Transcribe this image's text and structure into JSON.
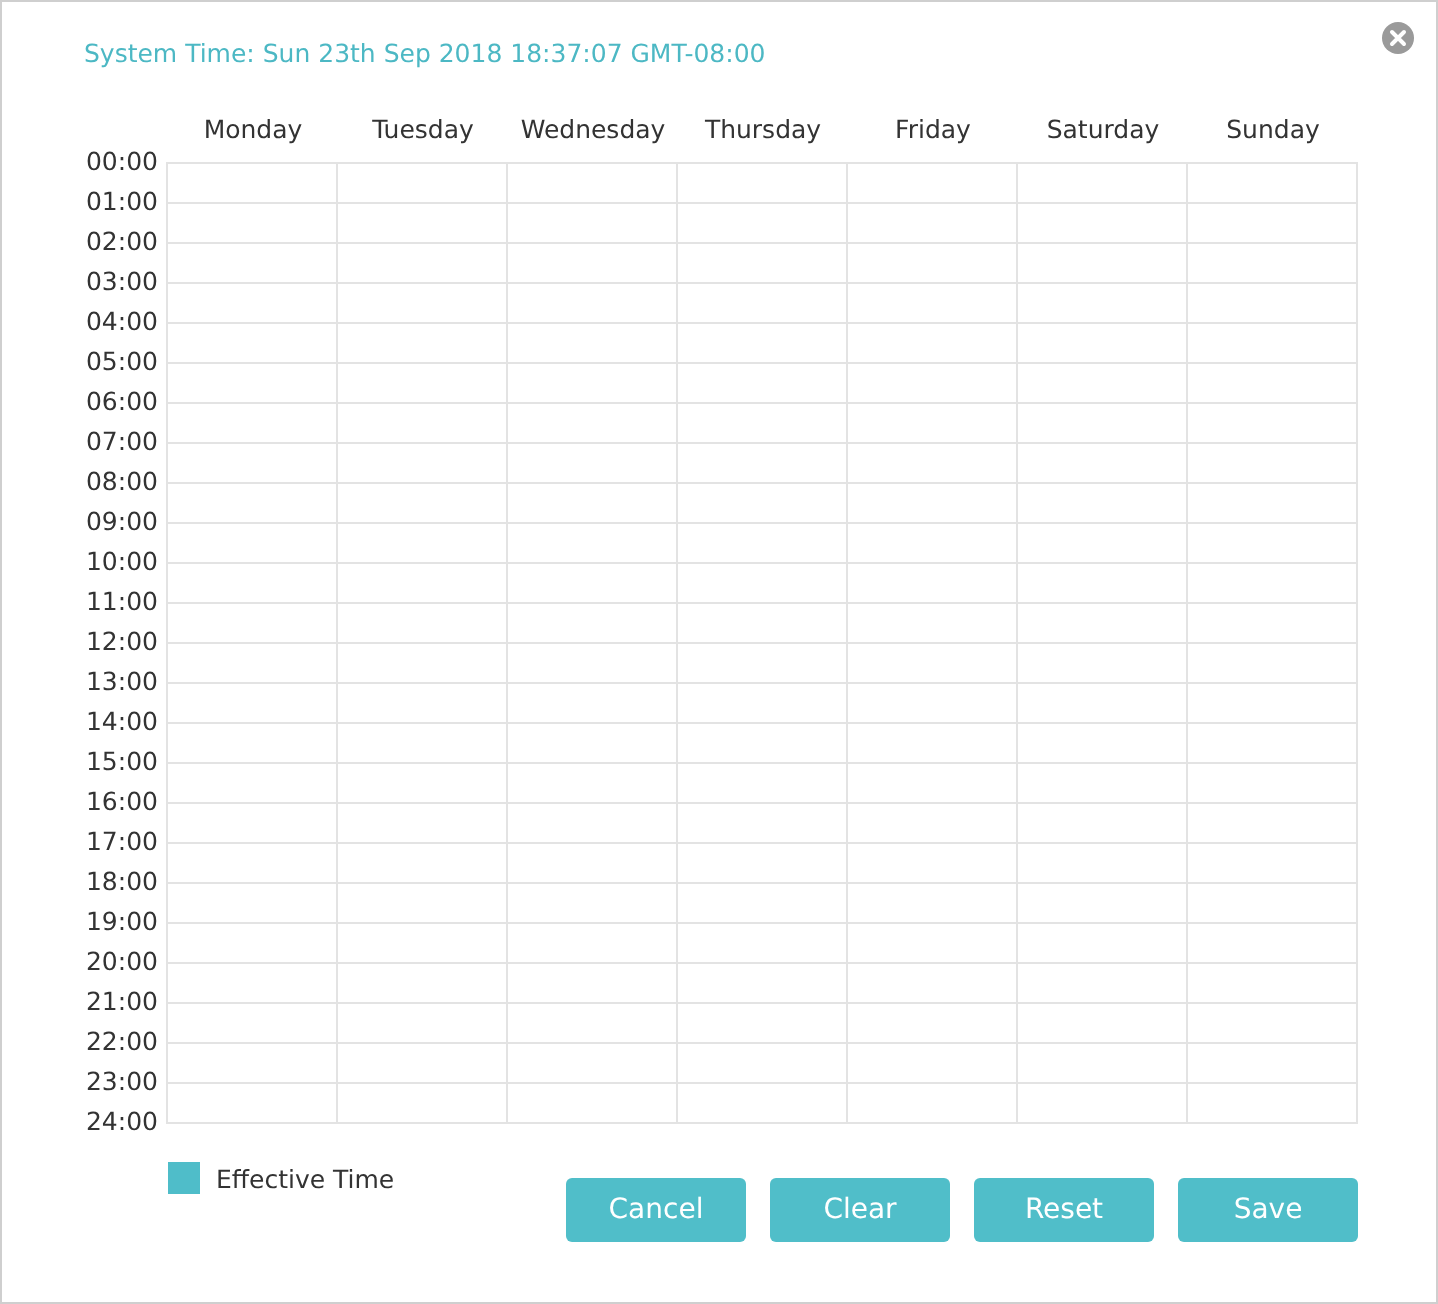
{
  "system_time": "System Time: Sun 23th Sep 2018 18:37:07 GMT-08:00",
  "days": [
    "Monday",
    "Tuesday",
    "Wednesday",
    "Thursday",
    "Friday",
    "Saturday",
    "Sunday"
  ],
  "hours": [
    "00:00",
    "01:00",
    "02:00",
    "03:00",
    "04:00",
    "05:00",
    "06:00",
    "07:00",
    "08:00",
    "09:00",
    "10:00",
    "11:00",
    "12:00",
    "13:00",
    "14:00",
    "15:00",
    "16:00",
    "17:00",
    "18:00",
    "19:00",
    "20:00",
    "21:00",
    "22:00",
    "23:00",
    "24:00"
  ],
  "legend": {
    "label": "Effective Time"
  },
  "buttons": [
    "Cancel",
    "Clear",
    "Reset",
    "Save"
  ]
}
